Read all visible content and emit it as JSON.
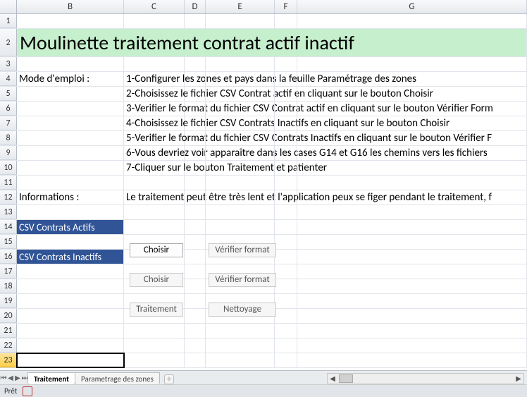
{
  "columns": [
    "B",
    "C",
    "D",
    "E",
    "F",
    "G"
  ],
  "rows": {
    "r1": "1",
    "r2": "2",
    "r3": "3",
    "r4": "4",
    "r5": "5",
    "r6": "6",
    "r7": "7",
    "r8": "8",
    "r9": "9",
    "r10": "10",
    "r11": "11",
    "r12": "12",
    "r13": "13",
    "r14": "14",
    "r15": "15",
    "r16": "16",
    "r17": "17",
    "r18": "18",
    "r19": "19",
    "r20": "20",
    "r21": "21",
    "r22": "22",
    "r23": "23"
  },
  "title": "Moulinette traitement contrat actif inactif",
  "labels": {
    "mode": "Mode d'emploi :",
    "info": "Informations :",
    "csv_actifs": "CSV Contrats Actifs",
    "csv_inactifs": "CSV Contrats Inactifs"
  },
  "instructions": {
    "i1": "1-Configurer les zones et pays dans la feuille Paramétrage des zones",
    "i2": "2-Choisissez le fichier CSV Contrat actif en cliquant sur le bouton Choisir",
    "i3": "3-Verifier le format du fichier CSV Contrat actif en cliquant sur le bouton Vérifier Form",
    "i4": "4-Choisissez le fichier CSV Contrats Inactifs en cliquant sur le bouton Choisir",
    "i5": "5-Verifier le format du fichier CSV Contrats Inactifs en cliquant sur le bouton Vérifier F",
    "i6": "6-Vous devriez voir apparaître dans les cases G14 et G16 les chemins vers les fichiers",
    "i7": "7-Cliquer sur le bouton Traitement et patienter"
  },
  "info_text": "Le traitement peut être très lent et l'application peux se figer pendant le traitement, f",
  "buttons": {
    "choisir": "Choisir",
    "verifier": "Vérifier format",
    "traitement": "Traitement",
    "nettoyage": "Nettoyage"
  },
  "tabs": {
    "t1": "Traitement",
    "t2": "Parametrage des zones"
  },
  "status": "Prêt"
}
